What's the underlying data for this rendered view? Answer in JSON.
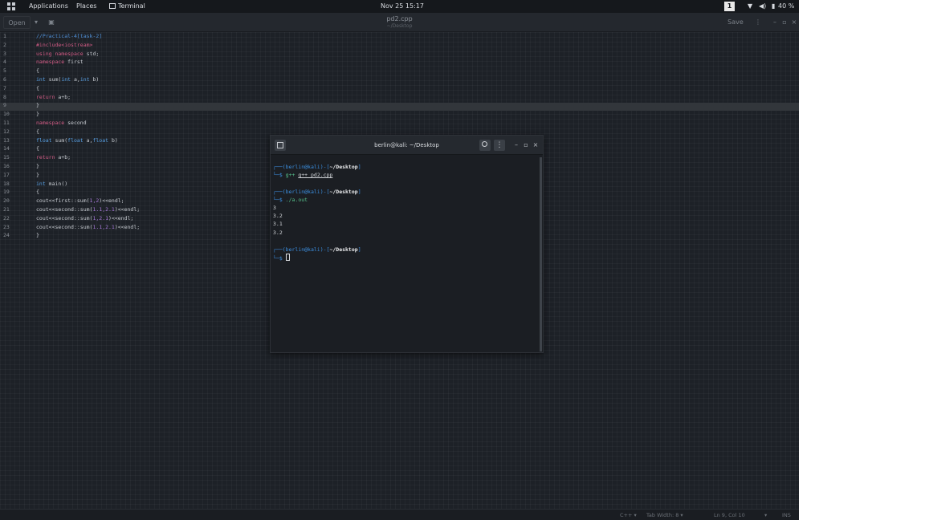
{
  "topbar": {
    "applications": "Applications",
    "places": "Places",
    "terminal": "Terminal",
    "clock": "Nov 25  15:17",
    "workspace": "1",
    "battery": "40 %"
  },
  "editor": {
    "open_label": "Open",
    "save_label": "Save",
    "filename": "pd2.cpp",
    "path": "~/Desktop",
    "lines": [
      {
        "n": "1",
        "segs": [
          {
            "t": "//Practical-4[task-2]",
            "c": "comment"
          }
        ]
      },
      {
        "n": "2",
        "segs": [
          {
            "t": "#include<iostream>",
            "c": "kw"
          }
        ]
      },
      {
        "n": "3",
        "segs": [
          {
            "t": "using namespace",
            "c": "kw"
          },
          {
            "t": " std;",
            "c": ""
          }
        ]
      },
      {
        "n": "4",
        "segs": [
          {
            "t": "namespace",
            "c": "kw"
          },
          {
            "t": " first",
            "c": ""
          }
        ]
      },
      {
        "n": "5",
        "segs": [
          {
            "t": "{",
            "c": ""
          }
        ]
      },
      {
        "n": "6",
        "segs": [
          {
            "t": "int",
            "c": "type"
          },
          {
            "t": " sum(",
            "c": ""
          },
          {
            "t": "int",
            "c": "type"
          },
          {
            "t": " a,",
            "c": ""
          },
          {
            "t": "int",
            "c": "type"
          },
          {
            "t": " b)",
            "c": ""
          }
        ]
      },
      {
        "n": "7",
        "segs": [
          {
            "t": "{",
            "c": ""
          }
        ]
      },
      {
        "n": "8",
        "segs": [
          {
            "t": "return",
            "c": "kw"
          },
          {
            "t": " a+b;",
            "c": ""
          }
        ]
      },
      {
        "n": "9",
        "segs": [
          {
            "t": "}",
            "c": ""
          }
        ]
      },
      {
        "n": "10",
        "segs": [
          {
            "t": "}",
            "c": ""
          }
        ]
      },
      {
        "n": "11",
        "segs": [
          {
            "t": "namespace",
            "c": "kw"
          },
          {
            "t": " second",
            "c": ""
          }
        ]
      },
      {
        "n": "12",
        "segs": [
          {
            "t": "{",
            "c": ""
          }
        ]
      },
      {
        "n": "13",
        "segs": [
          {
            "t": "float",
            "c": "type"
          },
          {
            "t": " sum(",
            "c": ""
          },
          {
            "t": "float",
            "c": "type"
          },
          {
            "t": " a,",
            "c": ""
          },
          {
            "t": "float",
            "c": "type"
          },
          {
            "t": " b)",
            "c": ""
          }
        ]
      },
      {
        "n": "14",
        "segs": [
          {
            "t": "{",
            "c": ""
          }
        ]
      },
      {
        "n": "15",
        "segs": [
          {
            "t": "return",
            "c": "kw"
          },
          {
            "t": " a+b;",
            "c": ""
          }
        ]
      },
      {
        "n": "16",
        "segs": [
          {
            "t": "}",
            "c": ""
          }
        ]
      },
      {
        "n": "17",
        "segs": [
          {
            "t": "}",
            "c": ""
          }
        ]
      },
      {
        "n": "18",
        "segs": [
          {
            "t": "int",
            "c": "type"
          },
          {
            "t": " main()",
            "c": ""
          }
        ]
      },
      {
        "n": "19",
        "segs": [
          {
            "t": "{",
            "c": ""
          }
        ]
      },
      {
        "n": "20",
        "segs": [
          {
            "t": "cout<<first::sum(",
            "c": ""
          },
          {
            "t": "1,2",
            "c": "num"
          },
          {
            "t": ")<<endl;",
            "c": ""
          }
        ]
      },
      {
        "n": "21",
        "segs": [
          {
            "t": "cout<<second::sum(",
            "c": ""
          },
          {
            "t": "1.1,2.1",
            "c": "num"
          },
          {
            "t": ")<<endl;",
            "c": ""
          }
        ]
      },
      {
        "n": "22",
        "segs": [
          {
            "t": "cout<<second::sum(",
            "c": ""
          },
          {
            "t": "1,2.1",
            "c": "num"
          },
          {
            "t": ")<<endl;",
            "c": ""
          }
        ]
      },
      {
        "n": "23",
        "segs": [
          {
            "t": "cout<<second::sum(",
            "c": ""
          },
          {
            "t": "1.1,2.1",
            "c": "num"
          },
          {
            "t": ")<<endl;",
            "c": ""
          }
        ]
      },
      {
        "n": "24",
        "segs": [
          {
            "t": "}",
            "c": ""
          }
        ]
      }
    ]
  },
  "statusbar": {
    "language": "C++",
    "tab_width": "Tab Width: 8",
    "position": "Ln 9, Col 10",
    "mode": "INS"
  },
  "terminal": {
    "title": "berlin@kali: ~/Desktop",
    "prompt_user": "(berlin@kali)",
    "prompt_dir": "~/Desktop",
    "cmd1": "g++ pd2.cpp",
    "cmd2": "./a.out",
    "outputs": [
      "3",
      "3.2",
      "3.1",
      "3.2"
    ]
  }
}
